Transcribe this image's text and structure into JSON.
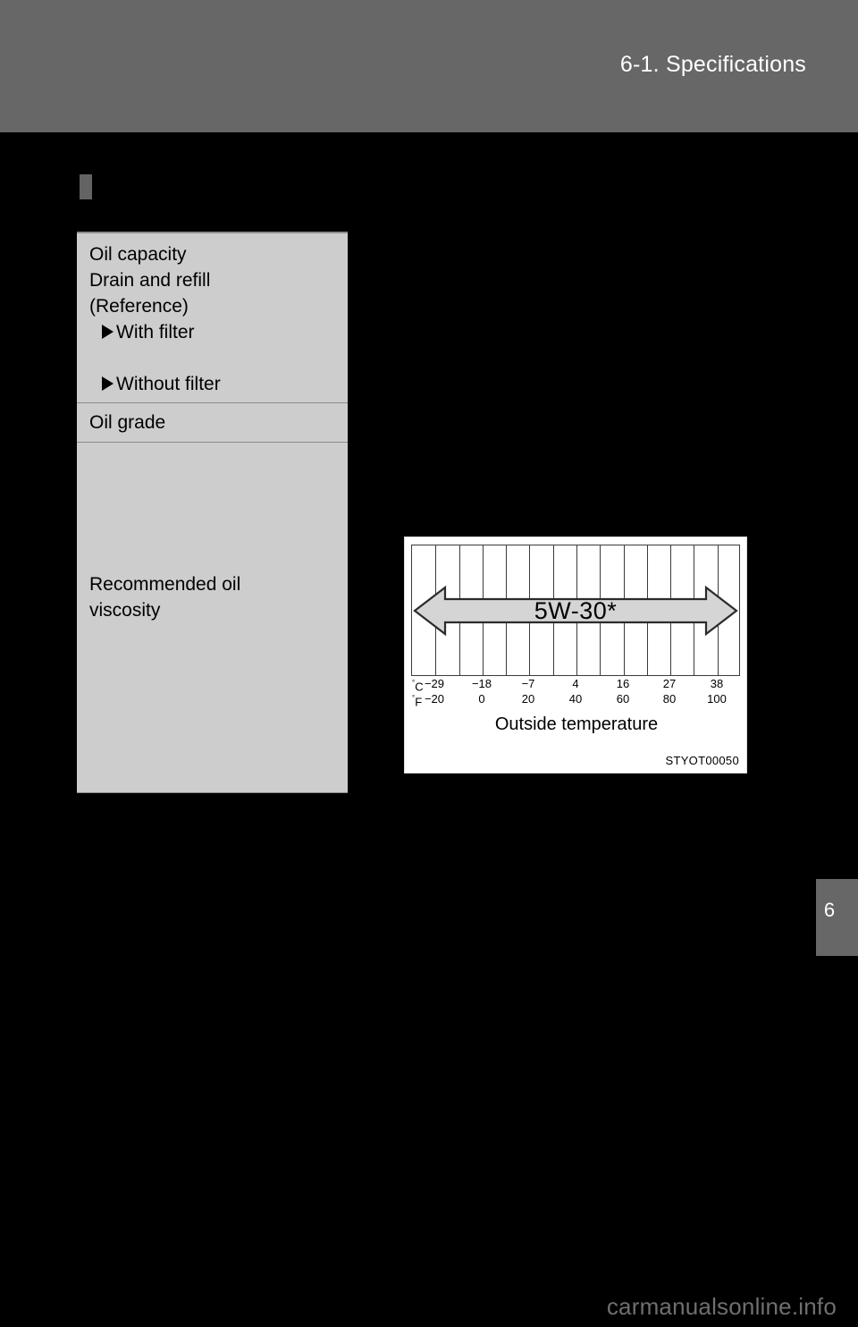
{
  "header": {
    "title": "6-1. Specifications"
  },
  "chapter_tab": {
    "number": "6"
  },
  "spec_table": {
    "rows": [
      {
        "id": "oil-capacity",
        "title": "Oil capacity",
        "line2": "Drain and refill",
        "line3": "(Reference)",
        "sub1": "With filter",
        "sub2": "Without filter"
      },
      {
        "id": "oil-grade",
        "title": "Oil grade"
      },
      {
        "id": "recommended-oil-viscosity",
        "title_line1": "Recommended oil",
        "title_line2": "viscosity"
      }
    ]
  },
  "figure": {
    "caption": "Outside temperature",
    "code": "STYOT00050",
    "arrow_label": "5W-30*",
    "unit_celsius": "C",
    "unit_fahrenheit": "F",
    "degree_symbol": "°"
  },
  "chart_data": {
    "type": "bar",
    "title": "Recommended oil viscosity",
    "xlabel": "Outside temperature",
    "ylabel": "",
    "grid": true,
    "legend_position": "none",
    "gridline_count": 13,
    "column_count": 14,
    "axes": [
      {
        "name": "Celsius",
        "unit": "°C",
        "tick_labels": [
          "−29",
          "−18",
          "−7",
          "4",
          "16",
          "27",
          "38"
        ],
        "tick_values": [
          -29,
          -18,
          -7,
          4,
          16,
          27,
          38
        ],
        "range": [
          -34,
          43
        ]
      },
      {
        "name": "Fahrenheit",
        "unit": "°F",
        "tick_labels": [
          "−20",
          "0",
          "20",
          "40",
          "60",
          "80",
          "100"
        ],
        "tick_values": [
          -20,
          0,
          20,
          40,
          60,
          80,
          100
        ],
        "range": [
          -30,
          110
        ]
      }
    ],
    "series": [
      {
        "name": "5W-30*",
        "label": "5W-30*",
        "kind": "range-arrow",
        "arrow_direction": "both",
        "start_celsius": -29,
        "end_celsius": 38,
        "start_fahrenheit": -20,
        "end_fahrenheit": 100,
        "note": "Double-headed arrow spanning the full outside temperature range"
      }
    ],
    "annotations": [
      "STYOT00050"
    ]
  },
  "footer": {
    "watermark": "carmanualsonline.info"
  },
  "colors": {
    "page_background": "#000000",
    "header_band": "#676767",
    "table_fill": "#cdcdcd",
    "table_rule": "#8c8c8c",
    "figure_background": "#ffffff",
    "arrow_fill": "#d5d5d5",
    "ink": "#000000"
  }
}
